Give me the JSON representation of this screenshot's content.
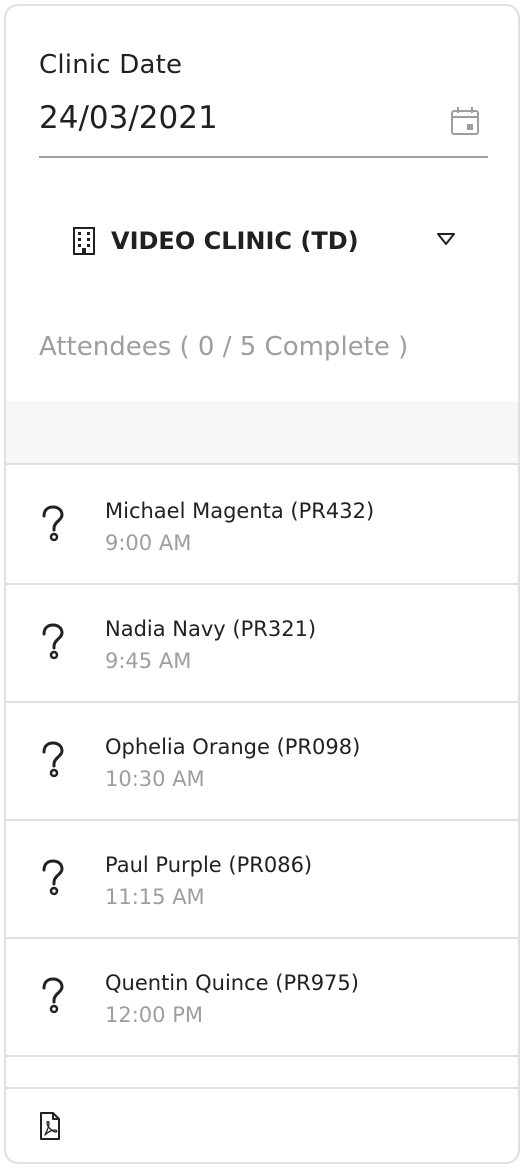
{
  "clinic_date": {
    "label": "Clinic Date",
    "value": "24/03/2021",
    "icon": "calendar-icon"
  },
  "clinic_selector": {
    "selected": "VIDEO CLINIC (TD)",
    "icon": "building-icon",
    "dropdown_icon": "chevron-down-icon"
  },
  "attendees_summary": "Attendees ( 0 / 5 Complete )",
  "attendees": [
    {
      "name": "Michael Magenta (PR432)",
      "time": "9:00 AM",
      "status_icon": "help-icon"
    },
    {
      "name": "Nadia Navy (PR321)",
      "time": "9:45 AM",
      "status_icon": "help-icon"
    },
    {
      "name": "Ophelia Orange (PR098)",
      "time": "10:30 AM",
      "status_icon": "help-icon"
    },
    {
      "name": "Paul Purple (PR086)",
      "time": "11:15 AM",
      "status_icon": "help-icon"
    },
    {
      "name": "Quentin Quince (PR975)",
      "time": "12:00 PM",
      "status_icon": "help-icon"
    }
  ],
  "footer": {
    "icon": "pdf-icon"
  },
  "colors": {
    "text": "#212121",
    "muted": "#9e9e9e",
    "divider": "#e0e0e0",
    "band": "#f5f7f9"
  }
}
